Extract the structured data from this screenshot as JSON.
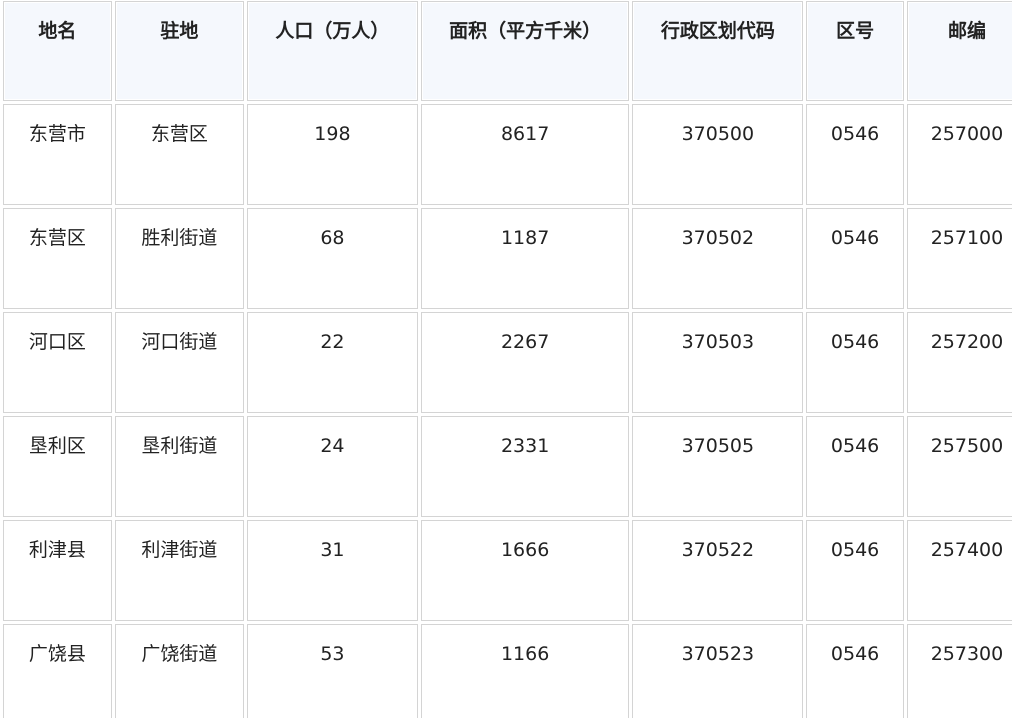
{
  "table": {
    "headers": [
      "地名",
      "驻地",
      "人口（万人）",
      "面积（平方千米）",
      "行政区划代码",
      "区号",
      "邮编"
    ],
    "rows": [
      [
        "东营市",
        "东营区",
        "198",
        "8617",
        "370500",
        "0546",
        "257000"
      ],
      [
        "东营区",
        "胜利街道",
        "68",
        "1187",
        "370502",
        "0546",
        "257100"
      ],
      [
        "河口区",
        "河口街道",
        "22",
        "2267",
        "370503",
        "0546",
        "257200"
      ],
      [
        "垦利区",
        "垦利街道",
        "24",
        "2331",
        "370505",
        "0546",
        "257500"
      ],
      [
        "利津县",
        "利津街道",
        "31",
        "1666",
        "370522",
        "0546",
        "257400"
      ],
      [
        "广饶县",
        "广饶街道",
        "53",
        "1166",
        "370523",
        "0546",
        "257300"
      ]
    ]
  }
}
